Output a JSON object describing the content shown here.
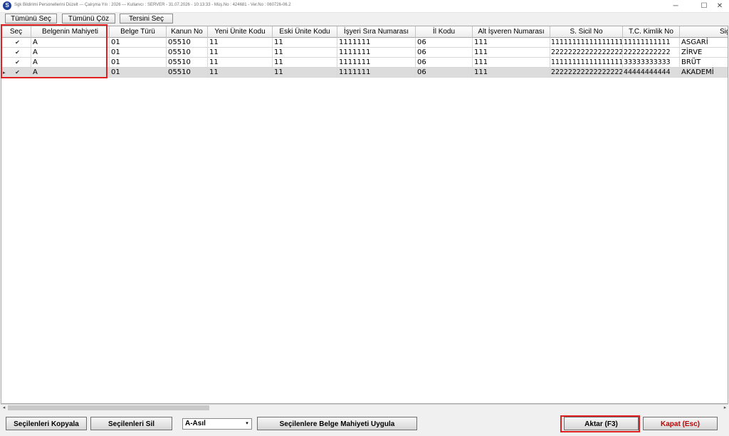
{
  "window": {
    "title": "Sgk Bildirimi Personellerini Düzelt  ---  Çalışma Yılı : 2026   ---   Kullanıcı : SERVER - 31.07.2026 - 10:13:33 - Müş.No : 424681 - Ver.No : 060726-06.2",
    "logo": "S",
    "minimize_glyph": "─",
    "maximize_glyph": "☐",
    "close_glyph": "✕"
  },
  "toolbar": {
    "select_all": "Tümünü Seç",
    "deselect_all": "Tümünü Çöz",
    "invert": "Tersini Seç"
  },
  "grid": {
    "columns": [
      "Seç",
      "Belgenin Mahiyeti",
      "Belge Türü",
      "Kanun No",
      "Yeni Ünite Kodu",
      "Eski Ünite Kodu",
      "İşyeri Sıra Numarası",
      "İl Kodu",
      "Alt İşveren Numarası",
      "S. Sicil No",
      "T.C. Kimlik No",
      "Sigor"
    ],
    "rows": [
      {
        "checked": "✔",
        "mahiyet": "A",
        "belge": "01",
        "kanun": "05510",
        "yeni": "11",
        "eski": "11",
        "sira": "1111111",
        "il": "06",
        "alt": "111",
        "sicil": "1111111111111111111",
        "tc": "11111111111",
        "sigorta": "ASGARİ"
      },
      {
        "checked": "✔",
        "mahiyet": "A",
        "belge": "01",
        "kanun": "05510",
        "yeni": "11",
        "eski": "11",
        "sira": "1111111",
        "il": "06",
        "alt": "111",
        "sicil": "2222222222222222222",
        "tc": "22222222222",
        "sigorta": "ZİRVE"
      },
      {
        "checked": "✔",
        "mahiyet": "A",
        "belge": "01",
        "kanun": "05510",
        "yeni": "11",
        "eski": "11",
        "sira": "1111111",
        "il": "06",
        "alt": "111",
        "sicil": "1111111111111111111",
        "tc": "33333333333",
        "sigorta": "BRÜT"
      },
      {
        "checked": "✔",
        "mahiyet": "A",
        "belge": "01",
        "kanun": "05510",
        "yeni": "11",
        "eski": "11",
        "sira": "1111111",
        "il": "06",
        "alt": "111",
        "sicil": "2222222222222222222",
        "tc": "44444444444",
        "sigorta": "AKADEMİ"
      }
    ],
    "current_row_marker": "▸"
  },
  "scrollbar": {
    "left_arrow": "◂",
    "right_arrow": "▸"
  },
  "bottom": {
    "copy": "Seçilenleri Kopyala",
    "delete": "Seçilenleri Sil",
    "combo_value": "A-Asıl",
    "combo_arrow": "▾",
    "apply": "Seçilenlere Belge Mahiyeti Uygula",
    "transfer": "Aktar (F3)",
    "close": "Kapat (Esc)"
  },
  "colors": {
    "highlight": "#e02020",
    "close_text": "#c00000",
    "selected_row": "#dcdcdc"
  }
}
